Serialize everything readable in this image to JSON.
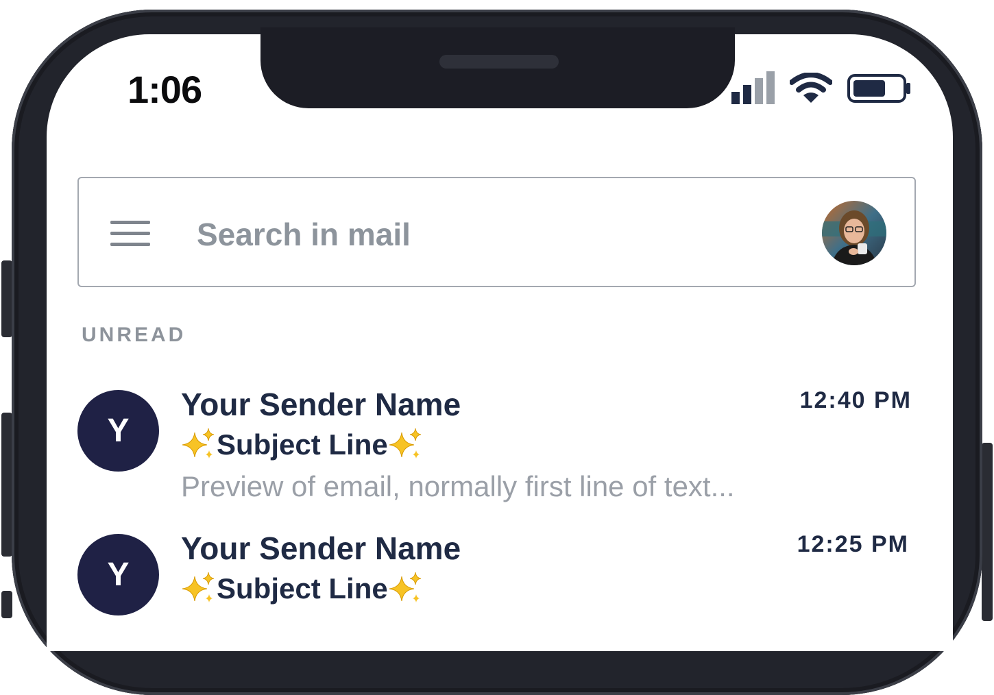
{
  "status_bar": {
    "time": "1:06"
  },
  "search": {
    "placeholder": "Search in mail",
    "menu_icon": "hamburger-menu-icon",
    "account_icon": "profile-avatar"
  },
  "section": {
    "label": "UNREAD"
  },
  "messages": [
    {
      "avatar_letter": "Y",
      "sender": "Your Sender Name",
      "time": "12:40 PM",
      "subject": "Subject Line",
      "subject_icon": "sparkles-icon",
      "preview": "Preview of email, normally first line of text..."
    },
    {
      "avatar_letter": "Y",
      "sender": "Your Sender Name",
      "time": "12:25 PM",
      "subject": "Subject Line",
      "subject_icon": "sparkles-icon"
    }
  ],
  "colors": {
    "avatar_bg": "#1f2145",
    "text_primary": "#1f2a44",
    "text_muted": "#8d949c",
    "phone_frame": "#22242c"
  }
}
